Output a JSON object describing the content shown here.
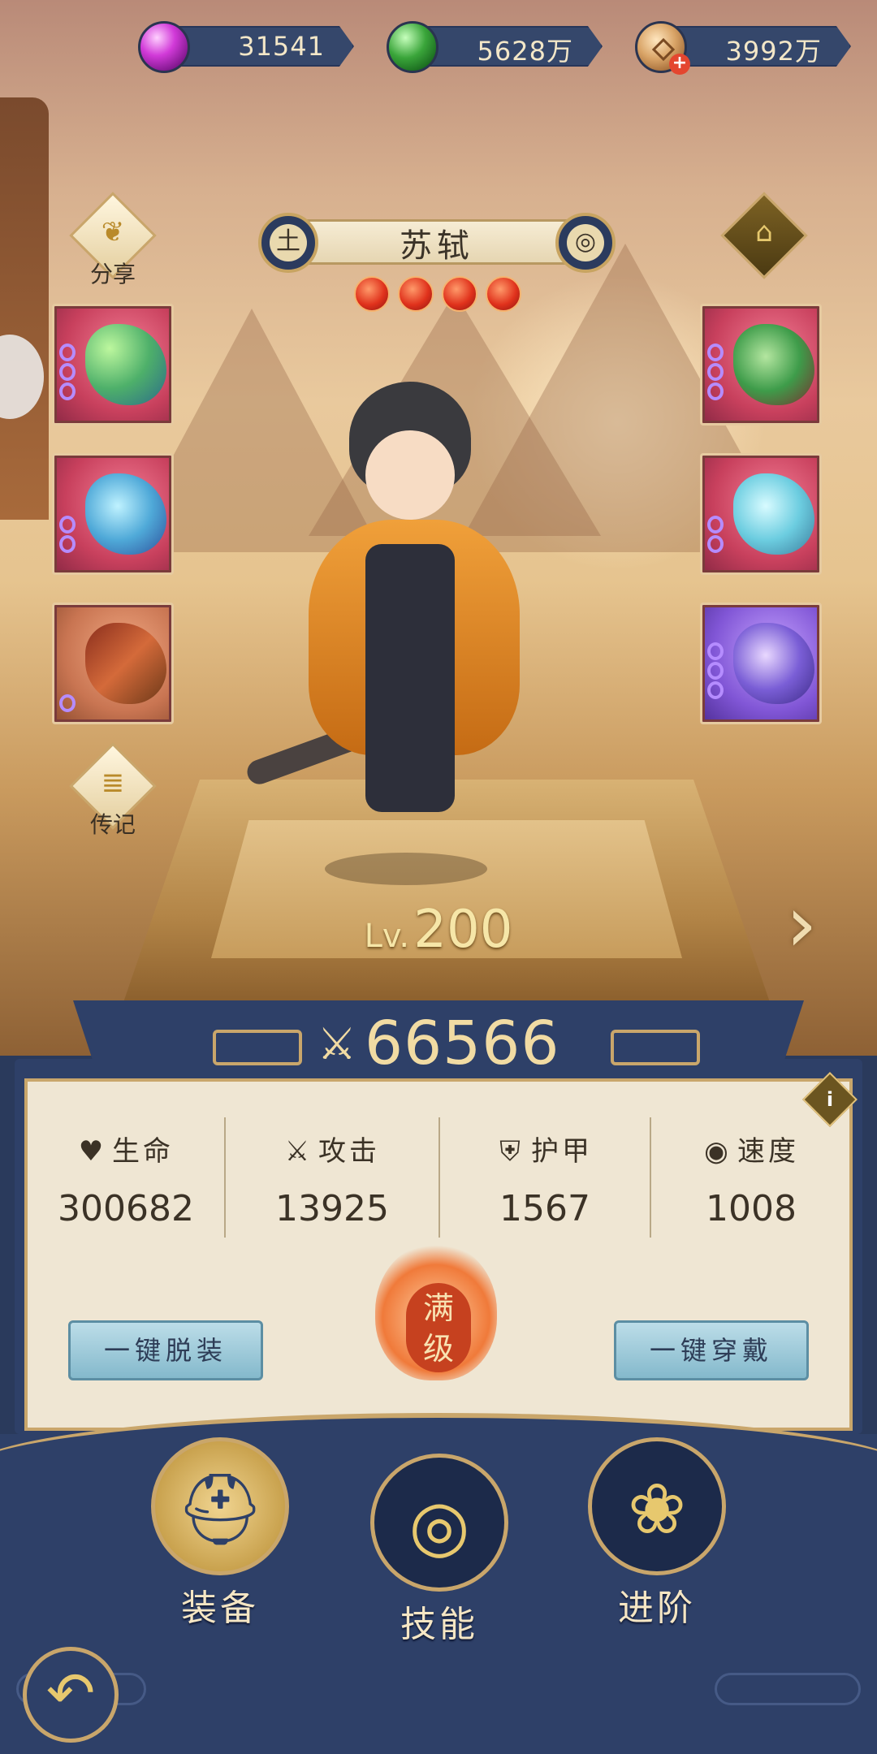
{
  "currencies": [
    {
      "id": "purple-gem",
      "value": "31541",
      "icon": "purple-orb-icon"
    },
    {
      "id": "green-gem",
      "value": "5628万",
      "icon": "green-orb-icon"
    },
    {
      "id": "copper-coin",
      "value": "3992万",
      "icon": "coin-icon"
    }
  ],
  "hero": {
    "name": "苏轼",
    "element_left": "土",
    "element_right": "◎",
    "star_count": 4,
    "level_prefix": "Lv.",
    "level": "200"
  },
  "side_buttons": {
    "share": "分享",
    "biography": "传记"
  },
  "equipment_icons": [
    "scepter-icon",
    "robe-icon",
    "book-icon",
    "boots-icon",
    "pendant-icon",
    "jade-icon"
  ],
  "power": "66566",
  "stats": [
    {
      "label": "生命",
      "value": "300682",
      "icon": "heart-icon"
    },
    {
      "label": "攻击",
      "value": "13925",
      "icon": "swords-icon"
    },
    {
      "label": "护甲",
      "value": "1567",
      "icon": "shield-icon"
    },
    {
      "label": "速度",
      "value": "1008",
      "icon": "swirl-icon"
    }
  ],
  "buttons": {
    "unequip_all": "一键脱装",
    "equip_all": "一键穿戴",
    "max_level": "满级"
  },
  "nav": [
    {
      "label": "装备",
      "icon": "helmet-icon",
      "active": true
    },
    {
      "label": "技能",
      "icon": "skill-icon",
      "active": false
    },
    {
      "label": "进阶",
      "icon": "phoenix-icon",
      "active": false
    }
  ]
}
